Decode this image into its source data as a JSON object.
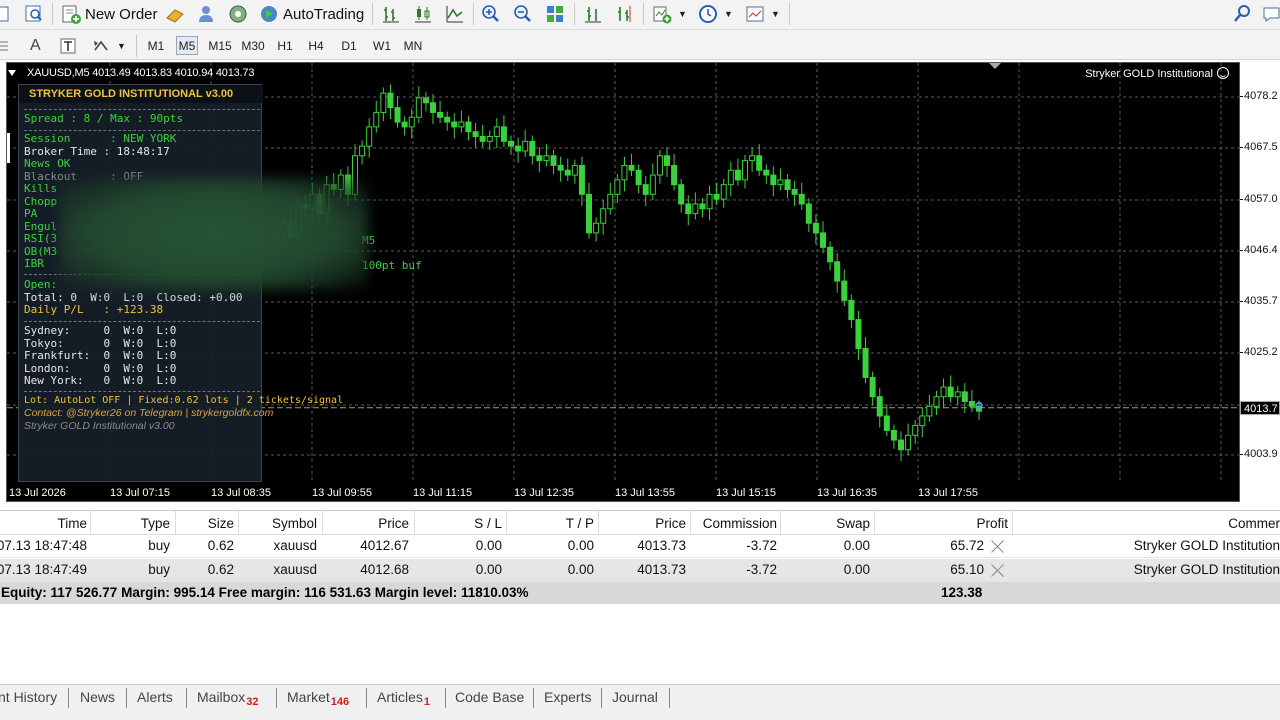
{
  "toolbar": {
    "new_order": "New Order",
    "autotrading": "AutoTrading",
    "timeframes": [
      "M1",
      "M5",
      "M15",
      "M30",
      "H1",
      "H4",
      "D1",
      "W1",
      "MN"
    ],
    "active_timeframe": "M5",
    "text_tool": "A"
  },
  "chart": {
    "symbol_label": "XAUUSD,M5  4013.49 4013.83 4010.94 4013.73",
    "ea_label": "Stryker GOLD Institutional",
    "price_ticks": [
      "4078.2",
      "4067.5",
      "4057.0",
      "4046.4",
      "4035.7",
      "4025.2",
      "4013.7",
      "4003.9"
    ],
    "current_price": "4013.7",
    "time_ticks": [
      "13 Jul 2026",
      "13 Jul 07:15",
      "13 Jul 08:35",
      "13 Jul 09:55",
      "13 Jul 11:15",
      "13 Jul 12:35",
      "13 Jul 13:55",
      "13 Jul 15:15",
      "13 Jul 16:35",
      "13 Jul 17:55"
    ],
    "ohlc": [
      4050,
      4052,
      4049,
      4056,
      4055,
      4058,
      4054,
      4060,
      4059,
      4062,
      4058,
      4066,
      4068,
      4072,
      4075,
      4079,
      4076,
      4073,
      4072,
      4074,
      4078,
      4077,
      4075,
      4074,
      4073,
      4072,
      4073,
      4071,
      4070,
      4069,
      4070,
      4072,
      4069,
      4068,
      4067,
      4069,
      4066,
      4065,
      4066,
      4064,
      4063,
      4062,
      4064,
      4058,
      4050,
      4052,
      4055,
      4058,
      4061,
      4064,
      4063,
      4060,
      4058,
      4062,
      4066,
      4064,
      4060,
      4056,
      4054,
      4056,
      4055,
      4058,
      4057,
      4060,
      4063,
      4061,
      4065,
      4066,
      4063,
      4062,
      4060,
      4061,
      4059,
      4058,
      4056,
      4052,
      4050,
      4047,
      4044,
      4040,
      4036,
      4032,
      4026,
      4020,
      4016,
      4012,
      4009,
      4007,
      4005,
      4008,
      4010,
      4012,
      4014,
      4016,
      4018,
      4016,
      4017,
      4015,
      4014,
      4013
    ]
  },
  "panel": {
    "title": "STRYKER GOLD INSTITUTIONAL v3.00",
    "spread": "Spread : 8 / Max : 90pts",
    "session": "Session      : NEW YORK",
    "broker_time": "Broker Time : 18:48:17",
    "news": "News OK",
    "blackout": "Blackout     : OFF",
    "killsw": "Kills",
    "chop": "Chopp",
    "pa": "PA",
    "engulf": "Engul",
    "rsi": "RSI(3",
    "ob": "OB(M3",
    "ibr": "IBR",
    "m5": "M5",
    "buf": "100pt buf",
    "open": "Open:",
    "total": "Total: 0  W:0  L:0  Closed: +0.00",
    "daily_pl": "Daily P/L   : +123.38",
    "sessions": [
      "Sydney:     0  W:0  L:0",
      "Tokyo:      0  W:0  L:0",
      "Frankfurt:  0  W:0  L:0",
      "London:     0  W:0  L:0",
      "New York:   0  W:0  L:0"
    ],
    "lot": "Lot: AutoLot OFF | Fixed:0.62 lots | 2 tickets/signal",
    "contact": "Contact: @Stryker26 on Telegram | strykergoldfx.com",
    "version": "Stryker GOLD Institutional v3.00"
  },
  "terminal": {
    "headers": [
      "Time",
      "Type",
      "Size",
      "Symbol",
      "Price",
      "S / L",
      "T / P",
      "Price",
      "Commission",
      "Swap",
      "Profit",
      "Commer"
    ],
    "rows": [
      [
        "07.13 18:47:48",
        "buy",
        "0.62",
        "xauusd",
        "4012.67",
        "0.00",
        "0.00",
        "4013.73",
        "-3.72",
        "0.00",
        "65.72",
        "Stryker GOLD Institution"
      ],
      [
        "07.13 18:47:49",
        "buy",
        "0.62",
        "xauusd",
        "4012.68",
        "0.00",
        "0.00",
        "4013.73",
        "-3.72",
        "0.00",
        "65.10",
        "Stryker GOLD Institution"
      ]
    ],
    "summary": "Equity: 117 526.77  Margin: 995.14  Free margin: 116 531.63  Margin level: 11810.03%",
    "summary_profit": "123.38"
  },
  "tabs": [
    {
      "label": "nt History",
      "badge": ""
    },
    {
      "label": "News",
      "badge": ""
    },
    {
      "label": "Alerts",
      "badge": ""
    },
    {
      "label": "Mailbox",
      "badge": "32"
    },
    {
      "label": "Market",
      "badge": "146"
    },
    {
      "label": "Articles",
      "badge": "1"
    },
    {
      "label": "Code Base",
      "badge": ""
    },
    {
      "label": "Experts",
      "badge": ""
    },
    {
      "label": "Journal",
      "badge": ""
    }
  ],
  "colors": {
    "candle": "#3ad23a",
    "panel_title": "#f0c23b",
    "badge": "#d0201a"
  }
}
